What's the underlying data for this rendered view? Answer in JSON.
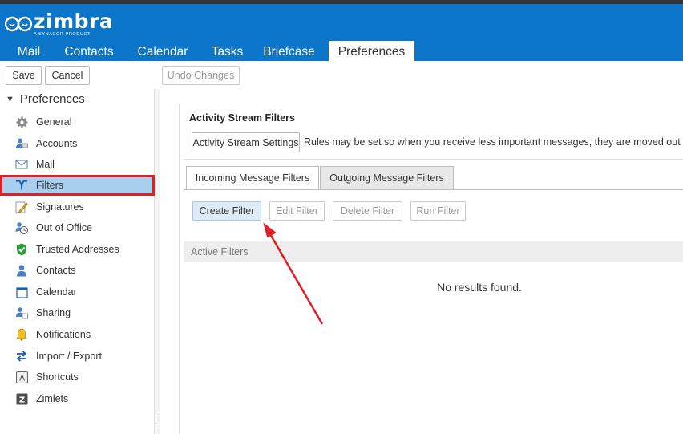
{
  "app": {
    "logo_text": "zimbra",
    "logo_subtext": "A SYNACOR PRODUCT",
    "brand_color": "#0b75c9"
  },
  "app_tabs": [
    {
      "label": "Mail"
    },
    {
      "label": "Contacts"
    },
    {
      "label": "Calendar"
    },
    {
      "label": "Tasks"
    },
    {
      "label": "Briefcase"
    },
    {
      "label": "Preferences",
      "active": true
    }
  ],
  "toolbar": {
    "save_label": "Save",
    "cancel_label": "Cancel",
    "undo_label": "Undo Changes"
  },
  "sidebar": {
    "root_label": "Preferences",
    "items": [
      {
        "label": "General",
        "icon": "gear-icon"
      },
      {
        "label": "Accounts",
        "icon": "accounts-icon"
      },
      {
        "label": "Mail",
        "icon": "mail-icon"
      },
      {
        "label": "Filters",
        "icon": "filter-icon",
        "selected": true
      },
      {
        "label": "Signatures",
        "icon": "signature-icon"
      },
      {
        "label": "Out of Office",
        "icon": "out-of-office-icon"
      },
      {
        "label": "Trusted Addresses",
        "icon": "shield-check-icon"
      },
      {
        "label": "Contacts",
        "icon": "contacts-icon"
      },
      {
        "label": "Calendar",
        "icon": "calendar-icon"
      },
      {
        "label": "Sharing",
        "icon": "sharing-icon"
      },
      {
        "label": "Notifications",
        "icon": "bell-icon"
      },
      {
        "label": "Import / Export",
        "icon": "import-export-icon"
      },
      {
        "label": "Shortcuts",
        "icon": "keyboard-shortcut-icon"
      },
      {
        "label": "Zimlets",
        "icon": "zimlet-icon"
      }
    ]
  },
  "activity_stream": {
    "title": "Activity Stream Filters",
    "settings_button": "Activity Stream Settings",
    "description": "Rules may be set so when you receive less important messages, they are moved out of yo"
  },
  "filter_tabs": [
    {
      "label": "Incoming Message Filters",
      "active": true
    },
    {
      "label": "Outgoing Message Filters"
    }
  ],
  "filter_actions": {
    "create": "Create Filter",
    "edit": "Edit Filter",
    "delete": "Delete Filter",
    "run": "Run Filter"
  },
  "filters_list": {
    "header": "Active Filters",
    "empty_message": "No results found."
  },
  "annotation_colors": {
    "highlight": "#e11e26"
  }
}
